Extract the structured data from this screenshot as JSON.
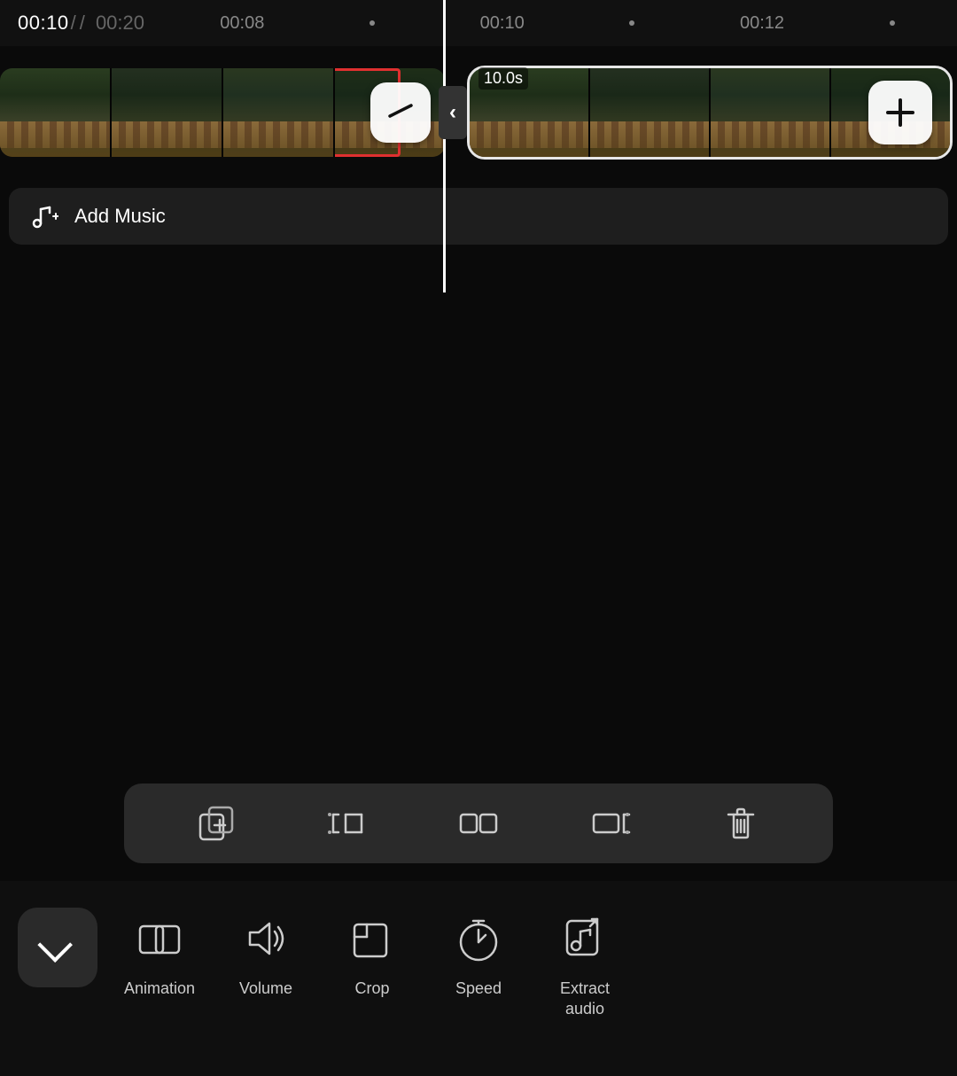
{
  "header": {
    "time_current": "00:10",
    "time_separator": "/",
    "time_total": "00:20",
    "ticks": [
      {
        "label": "00:08",
        "type": "time"
      },
      {
        "label": "•",
        "type": "dot"
      },
      {
        "label": "00:10",
        "type": "time"
      },
      {
        "label": "•",
        "type": "dot"
      },
      {
        "label": "00:12",
        "type": "time"
      },
      {
        "label": "•",
        "type": "dot"
      }
    ]
  },
  "clips": {
    "right_duration": "10.0s",
    "minus_icon": "−",
    "plus_icon": "+"
  },
  "add_music": {
    "label": "Add Music"
  },
  "edit_toolbar": {
    "buttons": [
      {
        "name": "duplicate",
        "icon": "duplicate"
      },
      {
        "name": "trim-start",
        "icon": "trim-start"
      },
      {
        "name": "split",
        "icon": "split"
      },
      {
        "name": "trim-end",
        "icon": "trim-end"
      },
      {
        "name": "delete",
        "icon": "delete"
      }
    ]
  },
  "bottom_toolbar": {
    "chevron_label": "chevron",
    "tools": [
      {
        "name": "animation",
        "label": "Animation"
      },
      {
        "name": "volume",
        "label": "Volume"
      },
      {
        "name": "crop",
        "label": "Crop"
      },
      {
        "name": "speed",
        "label": "Speed"
      },
      {
        "name": "extract-audio",
        "label": "Extract\naudio"
      }
    ]
  }
}
